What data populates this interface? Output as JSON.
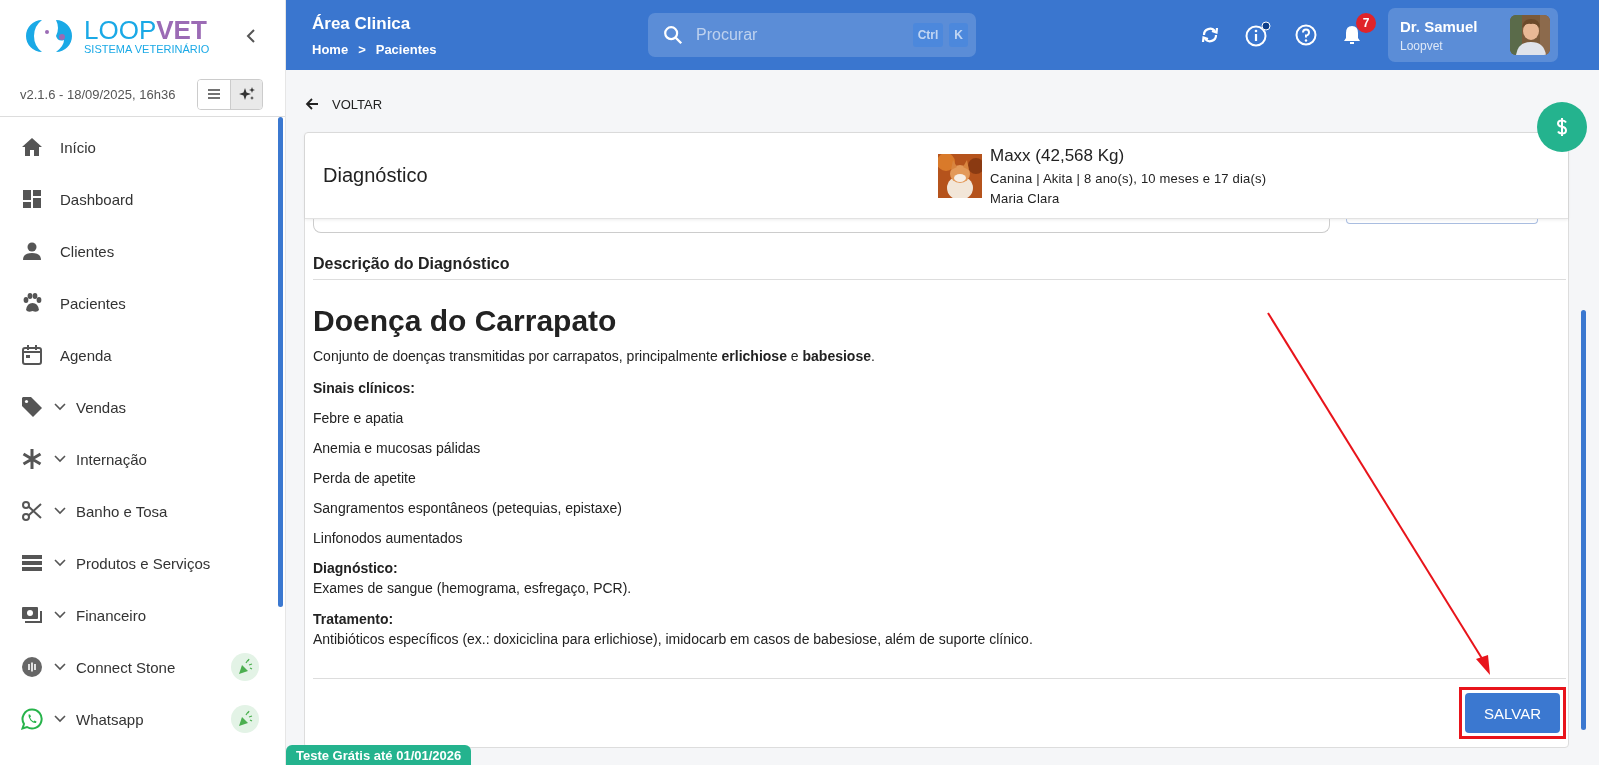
{
  "sidebar": {
    "logo": {
      "name_start": "LOOP",
      "name_end": "VET",
      "tagline": "SISTEMA VETERINÁRIO"
    },
    "version": "v2.1.6 - 18/09/2025, 16h36",
    "view_toggle": [
      {
        "selected": false
      },
      {
        "selected": true
      }
    ],
    "items": [
      {
        "label": "Início",
        "expandable": false,
        "promo": false
      },
      {
        "label": "Dashboard",
        "expandable": false,
        "promo": false
      },
      {
        "label": "Clientes",
        "expandable": false,
        "promo": false
      },
      {
        "label": "Pacientes",
        "expandable": false,
        "promo": false
      },
      {
        "label": "Agenda",
        "expandable": false,
        "promo": false
      },
      {
        "label": "Vendas",
        "expandable": true,
        "promo": false
      },
      {
        "label": "Internação",
        "expandable": true,
        "promo": false
      },
      {
        "label": "Banho e Tosa",
        "expandable": true,
        "promo": false
      },
      {
        "label": "Produtos e Serviços",
        "expandable": true,
        "promo": false
      },
      {
        "label": "Financeiro",
        "expandable": true,
        "promo": false
      },
      {
        "label": "Connect Stone",
        "expandable": true,
        "promo": true
      },
      {
        "label": "Whatsapp",
        "expandable": true,
        "promo": true
      }
    ]
  },
  "header": {
    "title": "Área Clinica",
    "breadcrumb": [
      "Home",
      "Pacientes"
    ],
    "breadcrumb_separator": ">",
    "search": {
      "placeholder": "Procurar",
      "shortcut": [
        "Ctrl",
        "K"
      ]
    },
    "notification_count": "7",
    "user": {
      "name": "Dr. Samuel",
      "organization": "Loopvet"
    }
  },
  "back_link": "VOLTAR",
  "card": {
    "title": "Diagnóstico",
    "patient": {
      "name": "Maxx (42,568 Kg)",
      "details": "Canina | Akita | 8 ano(s), 10 meses e 17 dia(s)",
      "owner": "Maria Clara"
    },
    "section_title": "Descrição do Diagnóstico",
    "blocks": [
      {
        "kind": "heading",
        "text": "Doença do Carrapato"
      },
      {
        "kind": "paragraph",
        "text": "Conjunto de doenças transmitidas por carrapatos, principalmente **erlichiose** e **babesiose**."
      },
      {
        "kind": "label",
        "text": "Sinais clínicos:"
      },
      {
        "kind": "item",
        "text": "Febre e apatia"
      },
      {
        "kind": "item",
        "text": "Anemia e mucosas pálidas"
      },
      {
        "kind": "item",
        "text": "Perda de apetite"
      },
      {
        "kind": "item",
        "text": "Sangramentos espontâneos (petequias, epistaxe)"
      },
      {
        "kind": "item",
        "text": "Linfonodos aumentados"
      },
      {
        "kind": "label",
        "text": "Diagnóstico:"
      },
      {
        "kind": "text",
        "text": "Exames de sangue (hemograma, esfregaço, PCR)."
      },
      {
        "kind": "label",
        "text": "Tratamento:"
      },
      {
        "kind": "text",
        "text": "Antibióticos específicos (ex.: doxiciclina para erlichiose), imidocarb em casos de babesiose, além de suporte clínico."
      }
    ],
    "save_button": "SALVAR"
  },
  "trial_badge": "Teste Grátis até 01/01/2026",
  "annotation": {
    "highlight_save": true
  }
}
